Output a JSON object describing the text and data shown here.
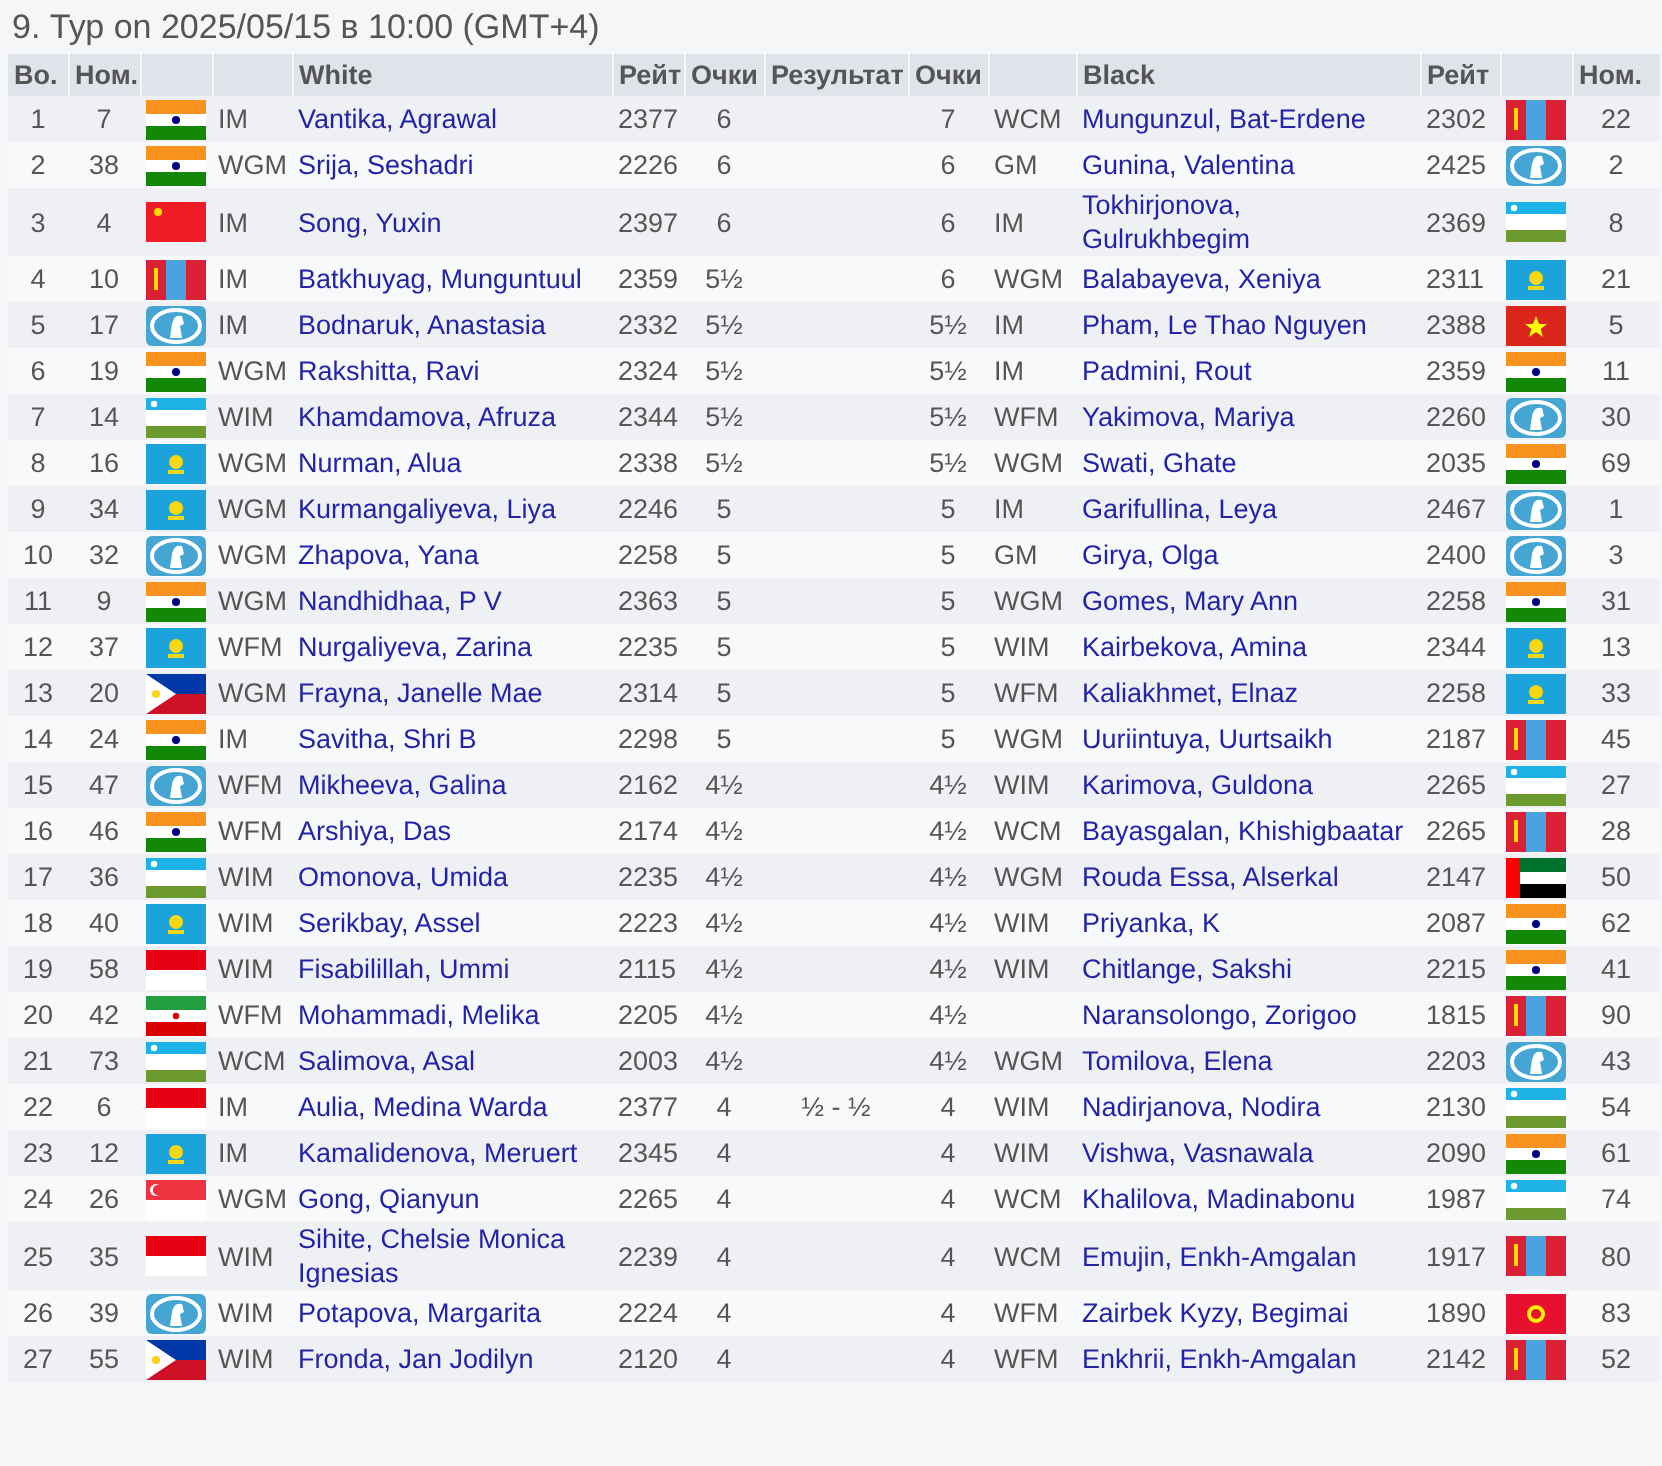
{
  "title": "9. Тур on 2025/05/15 в 10:00 (GMT+4)",
  "columns": [
    "Во.",
    "Ном.",
    "White",
    "Рейт",
    "Очки",
    "Результат",
    "Очки",
    "Black",
    "Рейт",
    "Ном."
  ],
  "rows": [
    {
      "board": "1",
      "white": {
        "no": "7",
        "flag": {
          "kind": "india"
        },
        "title": "IM",
        "name": "Vantika, Agrawal",
        "rating": "2377",
        "points": "6"
      },
      "black": {
        "points": "7",
        "title": "WCM",
        "name": "Mungunzul, Bat-Erdene",
        "rating": "2302",
        "flag": {
          "kind": "mongolia"
        },
        "no": "22"
      }
    },
    {
      "board": "2",
      "white": {
        "no": "38",
        "flag": {
          "kind": "india"
        },
        "title": "WGM",
        "name": "Srija, Seshadri",
        "rating": "2226",
        "points": "6"
      },
      "black": {
        "points": "6",
        "title": "GM",
        "name": "Gunina, Valentina",
        "rating": "2425",
        "flag": {
          "kind": "fide"
        },
        "no": "2"
      }
    },
    {
      "board": "3",
      "white": {
        "no": "4",
        "flag": {
          "kind": "china"
        },
        "title": "IM",
        "name": "Song, Yuxin",
        "rating": "2397",
        "points": "6"
      },
      "black": {
        "points": "6",
        "title": "IM",
        "name": "Tokhirjonova, Gulrukhbegim",
        "rating": "2369",
        "flag": {
          "kind": "uzbekistan"
        },
        "no": "8"
      }
    },
    {
      "board": "4",
      "white": {
        "no": "10",
        "flag": {
          "kind": "mongolia"
        },
        "title": "IM",
        "name": "Batkhuyag, Munguntuul",
        "rating": "2359",
        "points": "5½"
      },
      "black": {
        "points": "6",
        "title": "WGM",
        "name": "Balabayeva, Xeniya",
        "rating": "2311",
        "flag": {
          "kind": "kazakhstan"
        },
        "no": "21"
      }
    },
    {
      "board": "5",
      "white": {
        "no": "17",
        "flag": {
          "kind": "fide"
        },
        "title": "IM",
        "name": "Bodnaruk, Anastasia",
        "rating": "2332",
        "points": "5½"
      },
      "black": {
        "points": "5½",
        "title": "IM",
        "name": "Pham, Le Thao Nguyen",
        "rating": "2388",
        "flag": {
          "kind": "vietnam"
        },
        "no": "5"
      }
    },
    {
      "board": "6",
      "white": {
        "no": "19",
        "flag": {
          "kind": "india"
        },
        "title": "WGM",
        "name": "Rakshitta, Ravi",
        "rating": "2324",
        "points": "5½"
      },
      "black": {
        "points": "5½",
        "title": "IM",
        "name": "Padmini, Rout",
        "rating": "2359",
        "flag": {
          "kind": "india"
        },
        "no": "11"
      }
    },
    {
      "board": "7",
      "white": {
        "no": "14",
        "flag": {
          "kind": "uzbekistan"
        },
        "title": "WIM",
        "name": "Khamdamova, Afruza",
        "rating": "2344",
        "points": "5½"
      },
      "black": {
        "points": "5½",
        "title": "WFM",
        "name": "Yakimova, Mariya",
        "rating": "2260",
        "flag": {
          "kind": "fide"
        },
        "no": "30"
      }
    },
    {
      "board": "8",
      "white": {
        "no": "16",
        "flag": {
          "kind": "kazakhstan"
        },
        "title": "WGM",
        "name": "Nurman, Alua",
        "rating": "2338",
        "points": "5½"
      },
      "black": {
        "points": "5½",
        "title": "WGM",
        "name": "Swati, Ghate",
        "rating": "2035",
        "flag": {
          "kind": "india"
        },
        "no": "69"
      }
    },
    {
      "board": "9",
      "white": {
        "no": "34",
        "flag": {
          "kind": "kazakhstan"
        },
        "title": "WGM",
        "name": "Kurmangaliyeva, Liya",
        "rating": "2246",
        "points": "5"
      },
      "black": {
        "points": "5",
        "title": "IM",
        "name": "Garifullina, Leya",
        "rating": "2467",
        "flag": {
          "kind": "fide"
        },
        "no": "1"
      }
    },
    {
      "board": "10",
      "white": {
        "no": "32",
        "flag": {
          "kind": "fide"
        },
        "title": "WGM",
        "name": "Zhapova, Yana",
        "rating": "2258",
        "points": "5"
      },
      "black": {
        "points": "5",
        "title": "GM",
        "name": "Girya, Olga",
        "rating": "2400",
        "flag": {
          "kind": "fide"
        },
        "no": "3"
      }
    },
    {
      "board": "11",
      "white": {
        "no": "9",
        "flag": {
          "kind": "india"
        },
        "title": "WGM",
        "name": "Nandhidhaa, P V",
        "rating": "2363",
        "points": "5"
      },
      "black": {
        "points": "5",
        "title": "WGM",
        "name": "Gomes, Mary Ann",
        "rating": "2258",
        "flag": {
          "kind": "india"
        },
        "no": "31"
      }
    },
    {
      "board": "12",
      "white": {
        "no": "37",
        "flag": {
          "kind": "kazakhstan"
        },
        "title": "WFM",
        "name": "Nurgaliyeva, Zarina",
        "rating": "2235",
        "points": "5"
      },
      "black": {
        "points": "5",
        "title": "WIM",
        "name": "Kairbekova, Amina",
        "rating": "2344",
        "flag": {
          "kind": "kazakhstan"
        },
        "no": "13"
      }
    },
    {
      "board": "13",
      "white": {
        "no": "20",
        "flag": {
          "kind": "philippines"
        },
        "title": "WGM",
        "name": "Frayna, Janelle Mae",
        "rating": "2314",
        "points": "5"
      },
      "black": {
        "points": "5",
        "title": "WFM",
        "name": "Kaliakhmet, Elnaz",
        "rating": "2258",
        "flag": {
          "kind": "kazakhstan"
        },
        "no": "33"
      }
    },
    {
      "board": "14",
      "white": {
        "no": "24",
        "flag": {
          "kind": "india"
        },
        "title": "IM",
        "name": "Savitha, Shri B",
        "rating": "2298",
        "points": "5"
      },
      "black": {
        "points": "5",
        "title": "WGM",
        "name": "Uuriintuya, Uurtsaikh",
        "rating": "2187",
        "flag": {
          "kind": "mongolia"
        },
        "no": "45"
      }
    },
    {
      "board": "15",
      "white": {
        "no": "47",
        "flag": {
          "kind": "fide"
        },
        "title": "WFM",
        "name": "Mikheeva, Galina",
        "rating": "2162",
        "points": "4½"
      },
      "black": {
        "points": "4½",
        "title": "WIM",
        "name": "Karimova, Guldona",
        "rating": "2265",
        "flag": {
          "kind": "uzbekistan"
        },
        "no": "27"
      }
    },
    {
      "board": "16",
      "white": {
        "no": "46",
        "flag": {
          "kind": "india"
        },
        "title": "WFM",
        "name": "Arshiya, Das",
        "rating": "2174",
        "points": "4½"
      },
      "black": {
        "points": "4½",
        "title": "WCM",
        "name": "Bayasgalan, Khishigbaatar",
        "rating": "2265",
        "flag": {
          "kind": "mongolia"
        },
        "no": "28"
      }
    },
    {
      "board": "17",
      "white": {
        "no": "36",
        "flag": {
          "kind": "uzbekistan"
        },
        "title": "WIM",
        "name": "Omonova, Umida",
        "rating": "2235",
        "points": "4½"
      },
      "black": {
        "points": "4½",
        "title": "WGM",
        "name": "Rouda Essa, Alserkal",
        "rating": "2147",
        "flag": {
          "kind": "uae"
        },
        "no": "50"
      }
    },
    {
      "board": "18",
      "white": {
        "no": "40",
        "flag": {
          "kind": "kazakhstan"
        },
        "title": "WIM",
        "name": "Serikbay, Assel",
        "rating": "2223",
        "points": "4½"
      },
      "black": {
        "points": "4½",
        "title": "WIM",
        "name": "Priyanka, K",
        "rating": "2087",
        "flag": {
          "kind": "india"
        },
        "no": "62"
      }
    },
    {
      "board": "19",
      "white": {
        "no": "58",
        "flag": {
          "kind": "indonesia"
        },
        "title": "WIM",
        "name": "Fisabilillah, Ummi",
        "rating": "2115",
        "points": "4½"
      },
      "black": {
        "points": "4½",
        "title": "WIM",
        "name": "Chitlange, Sakshi",
        "rating": "2215",
        "flag": {
          "kind": "india"
        },
        "no": "41"
      }
    },
    {
      "board": "20",
      "white": {
        "no": "42",
        "flag": {
          "kind": "iran"
        },
        "title": "WFM",
        "name": "Mohammadi, Melika",
        "rating": "2205",
        "points": "4½"
      },
      "black": {
        "points": "4½",
        "name": "Naransolongo, Zorigoo",
        "rating": "1815",
        "flag": {
          "kind": "mongolia"
        },
        "no": "90"
      }
    },
    {
      "board": "21",
      "white": {
        "no": "73",
        "flag": {
          "kind": "uzbekistan"
        },
        "title": "WCM",
        "name": "Salimova, Asal",
        "rating": "2003",
        "points": "4½"
      },
      "black": {
        "points": "4½",
        "title": "WGM",
        "name": "Tomilova, Elena",
        "rating": "2203",
        "flag": {
          "kind": "fide"
        },
        "no": "43"
      }
    },
    {
      "board": "22",
      "white": {
        "no": "6",
        "flag": {
          "kind": "indonesia"
        },
        "title": "IM",
        "name": "Aulia, Medina Warda",
        "rating": "2377",
        "points": "4"
      },
      "result": "½ - ½",
      "black": {
        "points": "4",
        "title": "WIM",
        "name": "Nadirjanova, Nodira",
        "rating": "2130",
        "flag": {
          "kind": "uzbekistan"
        },
        "no": "54"
      }
    },
    {
      "board": "23",
      "white": {
        "no": "12",
        "flag": {
          "kind": "kazakhstan"
        },
        "title": "IM",
        "name": "Kamalidenova, Meruert",
        "rating": "2345",
        "points": "4"
      },
      "black": {
        "points": "4",
        "title": "WIM",
        "name": "Vishwa, Vasnawala",
        "rating": "2090",
        "flag": {
          "kind": "india"
        },
        "no": "61"
      }
    },
    {
      "board": "24",
      "white": {
        "no": "26",
        "flag": {
          "kind": "singapore"
        },
        "title": "WGM",
        "name": "Gong, Qianyun",
        "rating": "2265",
        "points": "4"
      },
      "black": {
        "points": "4",
        "title": "WCM",
        "name": "Khalilova, Madinabonu",
        "rating": "1987",
        "flag": {
          "kind": "uzbekistan"
        },
        "no": "74"
      }
    },
    {
      "board": "25",
      "white": {
        "no": "35",
        "flag": {
          "kind": "indonesia"
        },
        "title": "WIM",
        "name": "Sihite, Chelsie Monica Ignesias",
        "rating": "2239",
        "points": "4"
      },
      "black": {
        "points": "4",
        "title": "WCM",
        "name": "Emujin, Enkh-Amgalan",
        "rating": "1917",
        "flag": {
          "kind": "mongolia"
        },
        "no": "80"
      }
    },
    {
      "board": "26",
      "white": {
        "no": "39",
        "flag": {
          "kind": "fide"
        },
        "title": "WIM",
        "name": "Potapova, Margarita",
        "rating": "2224",
        "points": "4"
      },
      "black": {
        "points": "4",
        "title": "WFM",
        "name": "Zairbek Kyzy, Begimai",
        "rating": "1890",
        "flag": {
          "kind": "kyrgyzstan"
        },
        "no": "83"
      }
    },
    {
      "board": "27",
      "white": {
        "no": "55",
        "flag": {
          "kind": "philippines"
        },
        "title": "WIM",
        "name": "Fronda, Jan Jodilyn",
        "rating": "2120",
        "points": "4"
      },
      "black": {
        "points": "4",
        "title": "WFM",
        "name": "Enkhrii, Enkh-Amgalan",
        "rating": "2142",
        "flag": {
          "kind": "mongolia"
        },
        "no": "52"
      }
    }
  ]
}
